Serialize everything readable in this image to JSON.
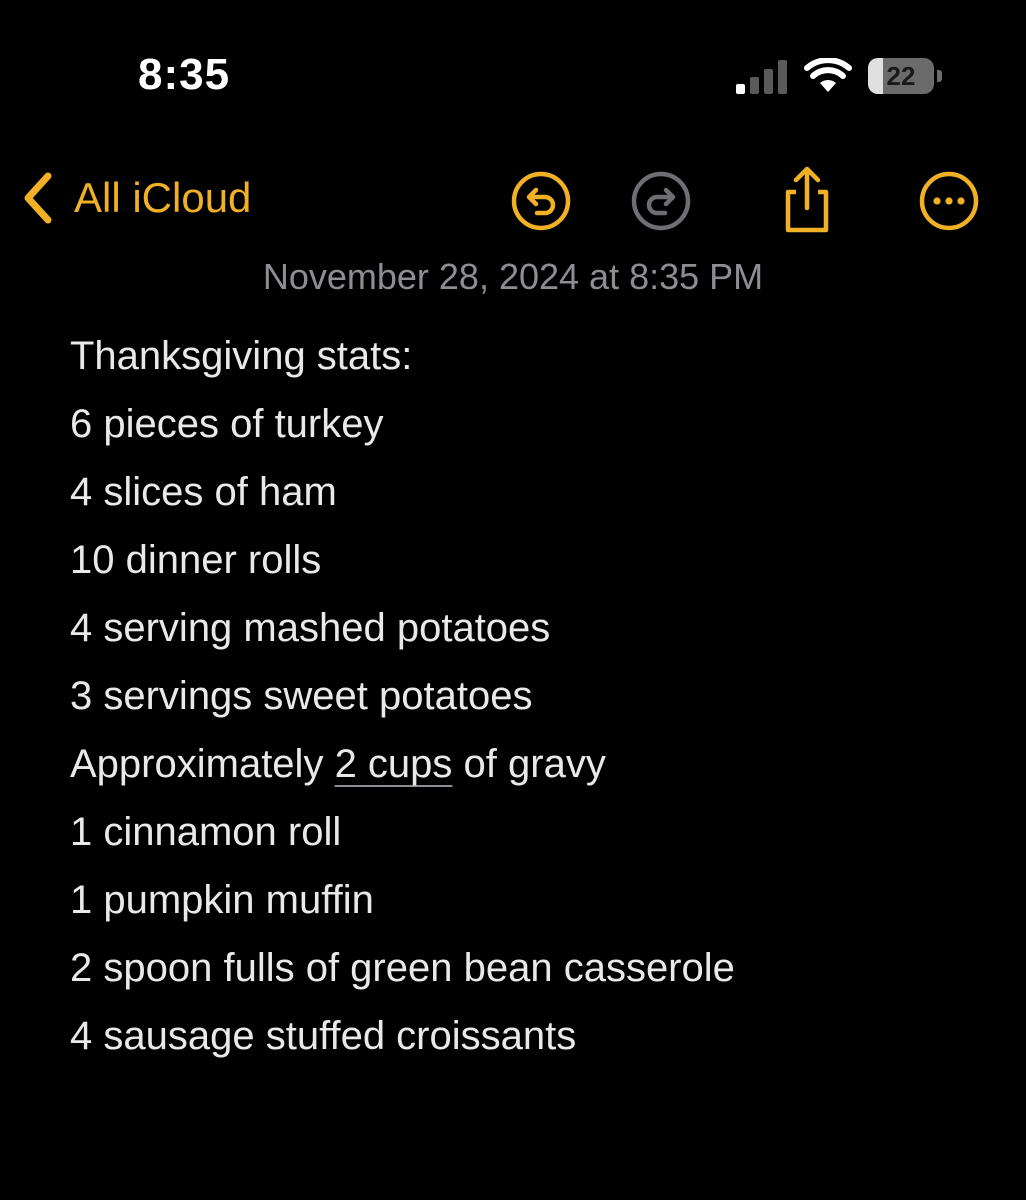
{
  "status_bar": {
    "time": "8:35",
    "battery_level": "22",
    "battery_fraction": 0.22,
    "signal_bars_active": 1,
    "signal_bars_total": 4
  },
  "nav": {
    "back_label": "All iCloud",
    "icons": {
      "undo": "undo-icon",
      "redo": "redo-icon",
      "share": "share-icon",
      "more": "more-icon"
    }
  },
  "note": {
    "date": "November 28, 2024 at 8:35 PM",
    "title": "Thanksgiving stats:",
    "lines": [
      "6 pieces of turkey",
      "4 slices of ham",
      "10 dinner rolls",
      "4 serving mashed potatoes",
      "3 servings sweet potatoes",
      {
        "before": "Approximately ",
        "link": "2 cups",
        "after": " of gravy"
      },
      "1 cinnamon roll",
      "1 pumpkin muffin",
      "2 spoon fulls of green bean casserole",
      "4 sausage stuffed croissants"
    ]
  },
  "colors": {
    "accent": "#f2b125",
    "background": "#000000",
    "text": "#e9e9e9",
    "secondary_text": "#8d8d92",
    "disabled_icon": "#6e6e73"
  }
}
